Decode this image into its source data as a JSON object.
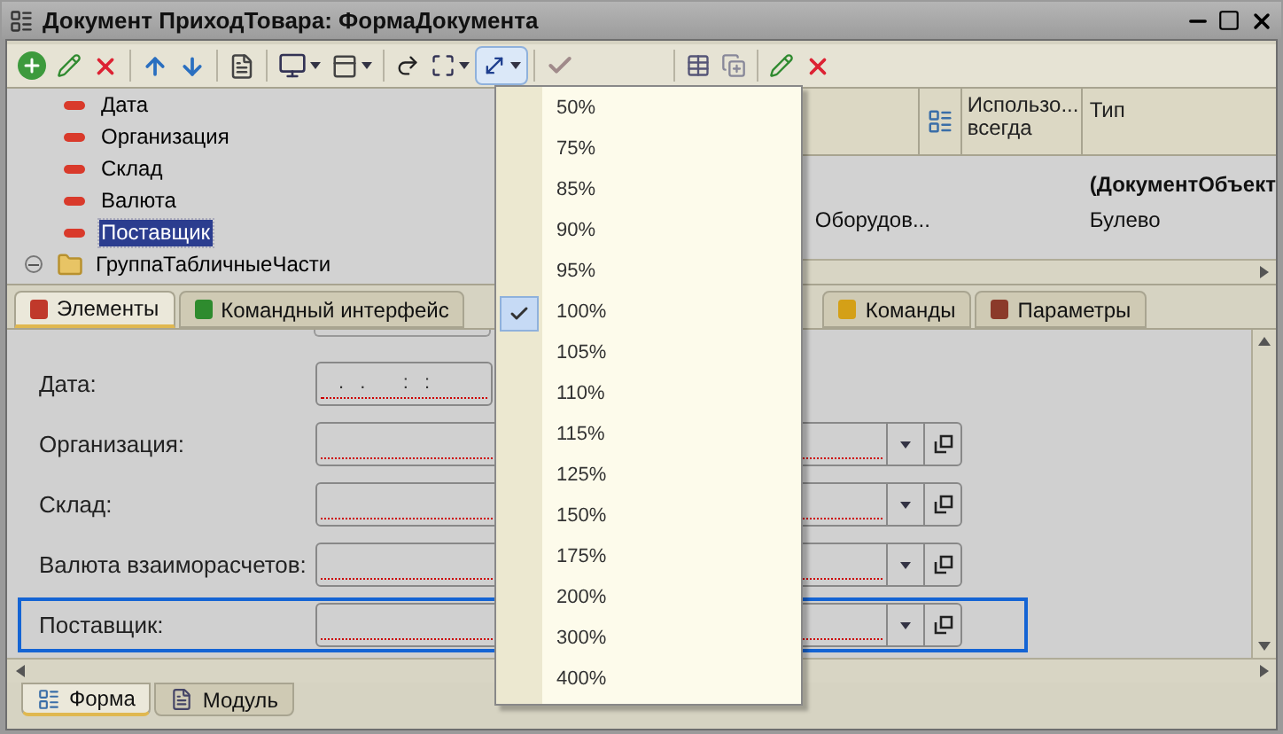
{
  "window": {
    "title": "Документ ПриходТовара: ФормаДокумента"
  },
  "tree": [
    {
      "label": "Дата",
      "kind": "attribute",
      "selected": false
    },
    {
      "label": "Организация",
      "kind": "attribute",
      "selected": false
    },
    {
      "label": "Склад",
      "kind": "attribute",
      "selected": false
    },
    {
      "label": "Валюта",
      "kind": "attribute",
      "selected": false
    },
    {
      "label": "Поставщик",
      "kind": "attribute",
      "selected": true
    },
    {
      "label": "ГруппаТабличныеЧасти",
      "kind": "group",
      "selected": false,
      "expanded": true
    }
  ],
  "table": {
    "columns": [
      "Использо... всегда",
      "Тип"
    ],
    "rows": [
      {
        "column_1": "",
        "type": "(ДокументОбъект",
        "kind": "object"
      },
      {
        "column_1": "Оборудов...",
        "type": "Булево",
        "kind": "plain"
      }
    ]
  },
  "upper_tabs": [
    {
      "label": "Элементы",
      "selected": true,
      "color": "#c0392b"
    },
    {
      "label": "Командный интерфейс",
      "selected": false,
      "color": "#2e8b2e"
    },
    {
      "label": "Команды",
      "selected": false,
      "color": "#d4a017"
    },
    {
      "label": "Параметры",
      "selected": false,
      "color": "#8b3a2a"
    }
  ],
  "form_fields": [
    {
      "label": "Дата:",
      "kind": "date",
      "value": ". .   : :",
      "focused": false
    },
    {
      "label": "Организация:",
      "kind": "reference",
      "focused": false
    },
    {
      "label": "Склад:",
      "kind": "reference",
      "focused": false
    },
    {
      "label": "Валюта взаиморасчетов:",
      "kind": "reference",
      "focused": false
    },
    {
      "label": "Поставщик:",
      "kind": "reference",
      "focused": true
    }
  ],
  "zoom_menu": [
    {
      "label": "50%",
      "checked": false
    },
    {
      "label": "75%",
      "checked": false
    },
    {
      "label": "85%",
      "checked": false
    },
    {
      "label": "90%",
      "checked": false
    },
    {
      "label": "95%",
      "checked": false
    },
    {
      "label": "100%",
      "checked": true
    },
    {
      "label": "105%",
      "checked": false
    },
    {
      "label": "110%",
      "checked": false
    },
    {
      "label": "115%",
      "checked": false
    },
    {
      "label": "125%",
      "checked": false
    },
    {
      "label": "150%",
      "checked": false
    },
    {
      "label": "175%",
      "checked": false
    },
    {
      "label": "200%",
      "checked": false
    },
    {
      "label": "300%",
      "checked": false
    },
    {
      "label": "400%",
      "checked": false
    }
  ],
  "bottom_tabs": [
    {
      "label": "Форма",
      "selected": true
    },
    {
      "label": "Модуль",
      "selected": false
    }
  ]
}
